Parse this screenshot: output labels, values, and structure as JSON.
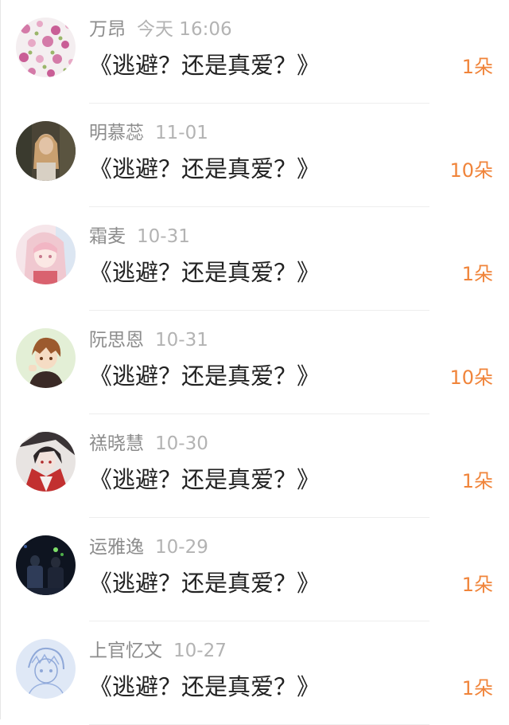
{
  "colors": {
    "accent": "#f0843a",
    "name": "#8c8c8c",
    "time": "#b3b3b3",
    "title": "#222222"
  },
  "items": [
    {
      "name": "万昂",
      "time": "今天 16:06",
      "title": "《逃避？还是真爱？》",
      "count": "1朵",
      "avatar": "floral-pattern"
    },
    {
      "name": "明慕蕊",
      "time": "11-01",
      "title": "《逃避？还是真爱？》",
      "count": "10朵",
      "avatar": "girl-photo"
    },
    {
      "name": "霜麦",
      "time": "10-31",
      "title": "《逃避？还是真爱？》",
      "count": "1朵",
      "avatar": "anime-girl-pink"
    },
    {
      "name": "阮思恩",
      "time": "10-31",
      "title": "《逃避？还是真爱？》",
      "count": "10朵",
      "avatar": "anime-boy"
    },
    {
      "name": "禚晓慧",
      "time": "10-30",
      "title": "《逃避？还是真爱？》",
      "count": "1朵",
      "avatar": "anime-character-red"
    },
    {
      "name": "运雅逸",
      "time": "10-29",
      "title": "《逃避？还是真爱？》",
      "count": "1朵",
      "avatar": "night-photo"
    },
    {
      "name": "上官忆文",
      "time": "10-27",
      "title": "《逃避？还是真爱？》",
      "count": "1朵",
      "avatar": "sketch-boy"
    }
  ]
}
